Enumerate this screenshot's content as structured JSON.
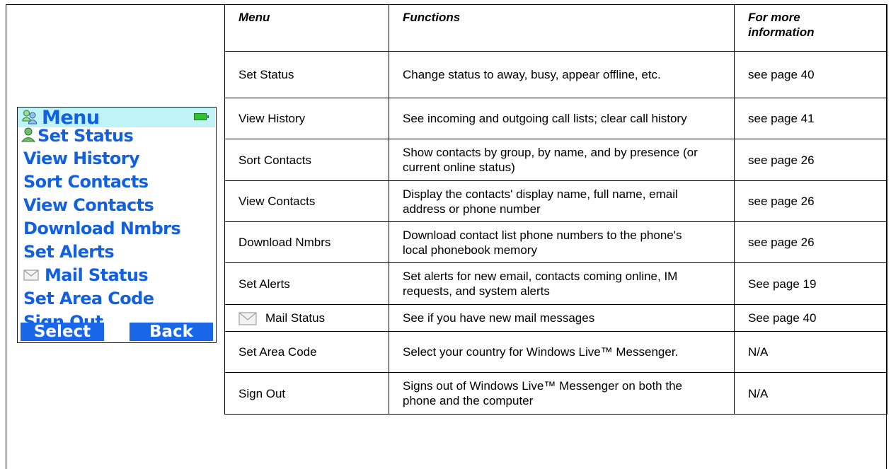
{
  "phone": {
    "title": "Menu",
    "items": [
      {
        "label": "Set Status",
        "icon": "person-icon"
      },
      {
        "label": "View History"
      },
      {
        "label": "Sort Contacts"
      },
      {
        "label": "View Contacts"
      },
      {
        "label": "Download Nmbrs"
      },
      {
        "label": "Set Alerts"
      },
      {
        "label": "Mail Status",
        "icon": "envelope-icon"
      },
      {
        "label": "Set Area Code"
      },
      {
        "label": "Sign Out"
      }
    ],
    "softkeys": {
      "left": "Select",
      "right": "Back"
    },
    "colors": {
      "title_bg": "#bff3f7",
      "item_text": "#1060e0",
      "softkey_bg": "#1a66e8",
      "battery": "#2ec22e"
    }
  },
  "table": {
    "headers": [
      "Menu",
      "Functions",
      "For more information"
    ],
    "rows": [
      {
        "menu": "Set Status",
        "function": "Change status to away, busy, appear offline, etc.",
        "info": "see page 40"
      },
      {
        "menu": "View History",
        "function": "See incoming and outgoing call lists; clear call history",
        "info": "see page 41"
      },
      {
        "menu": "Sort Contacts",
        "function": "Show contacts by group, by name, and by presence (or current online status)",
        "info": "see page 26"
      },
      {
        "menu": "View Contacts",
        "function": "Display the contacts' display name, full name, email address or phone number",
        "info": "see page 26"
      },
      {
        "menu": "Download Nmbrs",
        "function": "Download contact list phone numbers to the phone's local phonebook memory",
        "info": "see page 26"
      },
      {
        "menu": "Set Alerts",
        "function": "Set alerts for new email, contacts coming online, IM requests, and system alerts",
        "info": "See page 19"
      },
      {
        "menu": "Mail Status",
        "function": "See if you have new mail messages",
        "info": "See page 40",
        "icon": "envelope-icon"
      },
      {
        "menu": "Set Area Code",
        "function": "Select your country for Windows Live™ Messenger.",
        "info": "N/A"
      },
      {
        "menu": "Sign Out",
        "function": "Signs out of Windows Live™ Messenger on both the phone and the computer",
        "info": "N/A"
      }
    ]
  }
}
